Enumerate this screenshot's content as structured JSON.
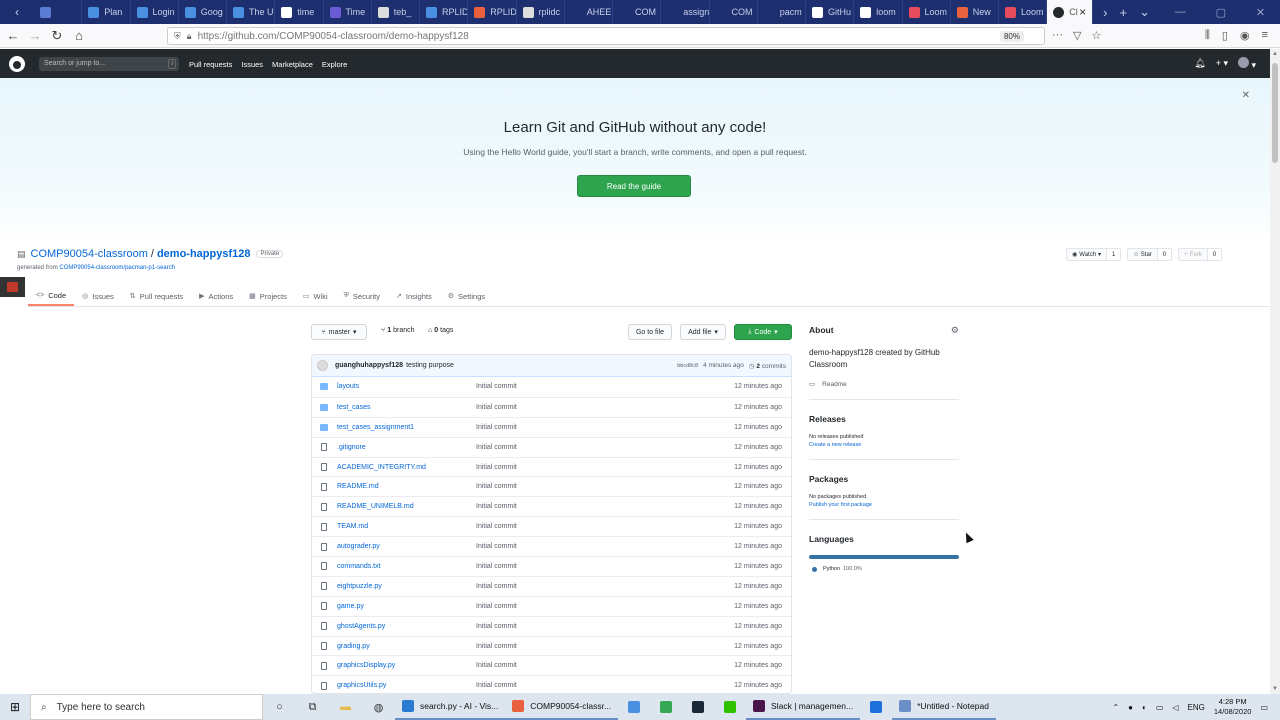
{
  "browser": {
    "tabs": [
      {
        "label": "",
        "color": "#5b7bd5"
      },
      {
        "label": "Plan",
        "color": "#4a90e2"
      },
      {
        "label": "Login",
        "color": "#4a90e2"
      },
      {
        "label": "Goog",
        "color": "#4a90e2"
      },
      {
        "label": "The U",
        "color": "#4a90e2"
      },
      {
        "label": "time",
        "color": "#ffffff"
      },
      {
        "label": "Time",
        "color": "#6b5bd5"
      },
      {
        "label": "teb_",
        "color": "#dddddd"
      },
      {
        "label": "RPLID",
        "color": "#4a90e2"
      },
      {
        "label": "RPLID",
        "color": "#e8613c"
      },
      {
        "label": "rplidc",
        "color": "#dddddd"
      },
      {
        "label": "AHEE",
        "color": "#1e2f70"
      },
      {
        "label": "COM",
        "color": "#1e2f70"
      },
      {
        "label": "assign",
        "color": "#1e2f70"
      },
      {
        "label": "COM",
        "color": "#1e2f70"
      },
      {
        "label": "pacm",
        "color": "#1e2f70"
      },
      {
        "label": "GitHu",
        "color": "#ffffff"
      },
      {
        "label": "loom",
        "color": "#ffffff"
      },
      {
        "label": "Loom",
        "color": "#e84b5b"
      },
      {
        "label": "New",
        "color": "#e8613c"
      },
      {
        "label": "Loom",
        "color": "#e84b5b"
      }
    ],
    "active_tab": {
      "label": "Cl",
      "close": "×"
    },
    "new_tab": "+",
    "tab_list": "⌄",
    "window": {
      "minimize": "—",
      "maximize": "▢",
      "close": "✕"
    },
    "url": "https://github.com/COMP90054-classroom/demo-happysf128",
    "zoom": "80%"
  },
  "github": {
    "search_placeholder": "Search or jump to...",
    "search_key": "/",
    "nav": [
      "Pull requests",
      "Issues",
      "Marketplace",
      "Explore"
    ],
    "banner": {
      "title": "Learn Git and GitHub without any code!",
      "subtitle": "Using the Hello World guide, you'll start a branch, write comments, and open a pull request.",
      "button": "Read the guide"
    },
    "repo": {
      "owner": "COMP90054-classroom",
      "separator": "/",
      "name": "demo-happysf128",
      "visibility": "Private",
      "generated_prefix": "generated from",
      "generated_from": "COMP90054-classroom/pacman-p1-search",
      "watch": {
        "label": "Watch",
        "count": "1"
      },
      "star": {
        "label": "Star",
        "count": "0"
      },
      "fork": {
        "label": "Fork",
        "count": "0"
      }
    },
    "tabs": [
      {
        "label": "Code",
        "icon": "<>"
      },
      {
        "label": "Issues",
        "icon": "◎"
      },
      {
        "label": "Pull requests",
        "icon": "⇅"
      },
      {
        "label": "Actions",
        "icon": "▶"
      },
      {
        "label": "Projects",
        "icon": "▦"
      },
      {
        "label": "Wiki",
        "icon": "▭"
      },
      {
        "label": "Security",
        "icon": "⛨"
      },
      {
        "label": "Insights",
        "icon": "↗"
      },
      {
        "label": "Settings",
        "icon": "⚙"
      }
    ],
    "toolbar": {
      "branch": "master",
      "branches_count": "1",
      "branches_label": "branch",
      "tags_count": "0",
      "tags_label": "tags",
      "go_to_file": "Go to file",
      "add_file": "Add file",
      "code": "Code"
    },
    "commit": {
      "author": "guanghuhappysf128",
      "message": "testing purpose",
      "hash": "bbcd8c8",
      "time": "4 minutes ago",
      "commits_count": "2",
      "commits_label": "commits"
    },
    "files": [
      {
        "name": "layouts",
        "type": "dir",
        "message": "Initial commit",
        "age": "12 minutes ago"
      },
      {
        "name": "test_cases",
        "type": "dir",
        "message": "Initial commit",
        "age": "12 minutes ago"
      },
      {
        "name": "test_cases_assignment1",
        "type": "dir",
        "message": "Initial commit",
        "age": "12 minutes ago"
      },
      {
        "name": ".gitignore",
        "type": "file",
        "message": "Initial commit",
        "age": "12 minutes ago"
      },
      {
        "name": "ACADEMIC_INTEGRITY.md",
        "type": "file",
        "message": "Initial commit",
        "age": "12 minutes ago"
      },
      {
        "name": "README.md",
        "type": "file",
        "message": "Initial commit",
        "age": "12 minutes ago"
      },
      {
        "name": "README_UNIMELB.md",
        "type": "file",
        "message": "Initial commit",
        "age": "12 minutes ago"
      },
      {
        "name": "TEAM.md",
        "type": "file",
        "message": "Initial commit",
        "age": "12 minutes ago"
      },
      {
        "name": "autograder.py",
        "type": "file",
        "message": "Initial commit",
        "age": "12 minutes ago"
      },
      {
        "name": "commands.txt",
        "type": "file",
        "message": "Initial commit",
        "age": "12 minutes ago"
      },
      {
        "name": "eightpuzzle.py",
        "type": "file",
        "message": "Initial commit",
        "age": "12 minutes ago"
      },
      {
        "name": "game.py",
        "type": "file",
        "message": "Initial commit",
        "age": "12 minutes ago"
      },
      {
        "name": "ghostAgents.py",
        "type": "file",
        "message": "Initial commit",
        "age": "12 minutes ago"
      },
      {
        "name": "grading.py",
        "type": "file",
        "message": "Initial commit",
        "age": "12 minutes ago"
      },
      {
        "name": "graphicsDisplay.py",
        "type": "file",
        "message": "Initial commit",
        "age": "12 minutes ago"
      },
      {
        "name": "graphicsUtils.py",
        "type": "file",
        "message": "Initial commit",
        "age": "12 minutes ago"
      }
    ],
    "sidebar": {
      "about_title": "About",
      "description": "demo-happysf128 created by GitHub Classroom",
      "readme": "Readme",
      "releases_title": "Releases",
      "releases_empty": "No releases published",
      "releases_link": "Create a new release",
      "packages_title": "Packages",
      "packages_empty": "No packages published",
      "packages_link": "Publish your first package",
      "languages_title": "Languages",
      "language": "Python",
      "language_pct": "100.0%",
      "language_share": 1.0,
      "language_color": "#3572a5"
    }
  },
  "taskbar": {
    "search_placeholder": "Type here to search",
    "apps": [
      {
        "label": "search.py - AI - Vis...",
        "color": "#2b7bd5"
      },
      {
        "label": "COMP90054-classr...",
        "color": "#e8613c"
      },
      {
        "label": "",
        "color": "#4a90e2"
      },
      {
        "label": "",
        "color": "#34a853"
      },
      {
        "label": "",
        "color": "#1b2838"
      },
      {
        "label": "",
        "color": "#2dc100"
      },
      {
        "label": "Slack | managemen...",
        "color": "#4a154b"
      },
      {
        "label": "",
        "color": "#1e6fd9"
      },
      {
        "label": "*Untitled - Notepad",
        "color": "#6a8fc7"
      }
    ],
    "language": "ENG",
    "time": "4:28 PM",
    "date": "14/08/2020"
  }
}
